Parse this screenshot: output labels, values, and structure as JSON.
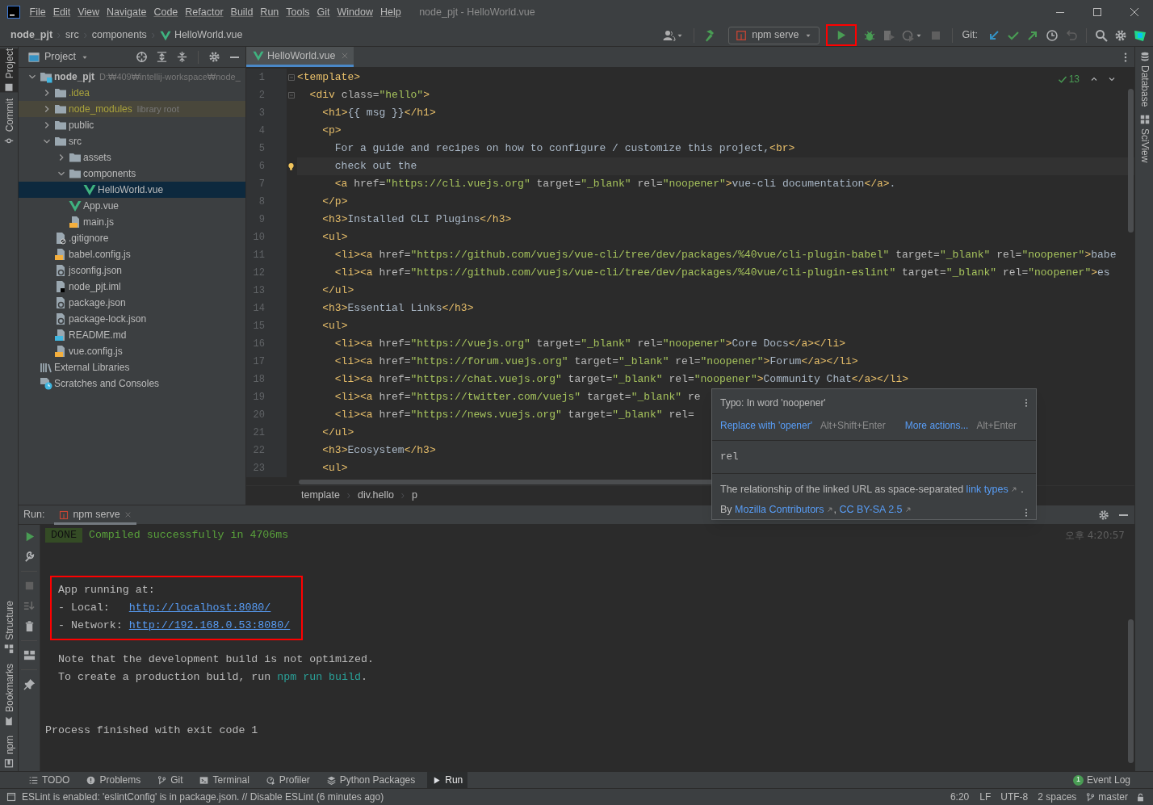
{
  "window": {
    "title": "node_pjt - HelloWorld.vue"
  },
  "menu": [
    "File",
    "Edit",
    "View",
    "Navigate",
    "Code",
    "Refactor",
    "Build",
    "Run",
    "Tools",
    "Git",
    "Window",
    "Help"
  ],
  "breadcrumbs": [
    {
      "label": "node_pjt",
      "kind": "project"
    },
    {
      "label": "src",
      "kind": "folder"
    },
    {
      "label": "components",
      "kind": "folder"
    },
    {
      "label": "HelloWorld.vue",
      "kind": "vue"
    }
  ],
  "toolbar": {
    "run_config": "npm serve",
    "run_highlighted": true,
    "git_label": "Git:"
  },
  "left_strip": {
    "top": [
      {
        "label": "Project",
        "selected": true
      },
      {
        "label": "Commit",
        "selected": false
      }
    ],
    "bottom": [
      {
        "label": "Structure",
        "selected": false
      },
      {
        "label": "Bookmarks",
        "selected": false
      },
      {
        "label": "npm",
        "selected": false
      }
    ]
  },
  "right_strip": [
    {
      "label": "Database",
      "kind": "database"
    },
    {
      "label": "SciView",
      "kind": "sciview"
    }
  ],
  "project_panel": {
    "title": "Project",
    "tree": [
      {
        "name": "node_pjt",
        "kind": "module",
        "hint": "D:₩409₩intellij-workspace₩node_",
        "expanded": true,
        "selected": false,
        "children": [
          {
            "name": ".idea",
            "kind": "folder",
            "ignored": true,
            "expanded": false,
            "selected": false
          },
          {
            "name": "node_modules",
            "kind": "library_folder",
            "ignored": true,
            "hint": "library root",
            "expanded": false,
            "selected": false
          },
          {
            "name": "public",
            "kind": "folder",
            "expanded": false,
            "selected": false
          },
          {
            "name": "src",
            "kind": "folder",
            "expanded": true,
            "selected": false,
            "children": [
              {
                "name": "assets",
                "kind": "folder",
                "expanded": false,
                "selected": false
              },
              {
                "name": "components",
                "kind": "folder",
                "expanded": true,
                "selected": false,
                "children": [
                  {
                    "name": "HelloWorld.vue",
                    "kind": "vue",
                    "selected": true
                  }
                ]
              },
              {
                "name": "App.vue",
                "kind": "vue",
                "selected": false
              },
              {
                "name": "main.js",
                "kind": "js",
                "selected": false
              }
            ]
          },
          {
            "name": ".gitignore",
            "kind": "gitignore",
            "selected": false
          },
          {
            "name": "babel.config.js",
            "kind": "js",
            "selected": false
          },
          {
            "name": "jsconfig.json",
            "kind": "json",
            "selected": false
          },
          {
            "name": "node_pjt.iml",
            "kind": "iml",
            "selected": false
          },
          {
            "name": "package.json",
            "kind": "json",
            "selected": false
          },
          {
            "name": "package-lock.json",
            "kind": "json",
            "selected": false
          },
          {
            "name": "README.md",
            "kind": "md",
            "selected": false
          },
          {
            "name": "vue.config.js",
            "kind": "js",
            "selected": false
          }
        ]
      },
      {
        "name": "External Libraries",
        "kind": "libraries",
        "selected": false
      },
      {
        "name": "Scratches and Consoles",
        "kind": "scratches",
        "selected": false
      }
    ]
  },
  "editor": {
    "tabs": [
      {
        "label": "HelloWorld.vue",
        "selected": true
      }
    ],
    "inspection_count": "13",
    "lines": [
      {
        "number": "1",
        "text": "<template>",
        "fold": true,
        "current": false
      },
      {
        "number": "2",
        "text": "  <div class=\"hello\">",
        "fold": true,
        "current": false
      },
      {
        "number": "3",
        "text": "    <h1>{{ msg }}</h1>",
        "fold": false,
        "current": false
      },
      {
        "number": "4",
        "text": "    <p>",
        "fold": false,
        "current": false
      },
      {
        "number": "5",
        "text": "      For a guide and recipes on how to configure / customize this project,<br>",
        "fold": false,
        "current": false
      },
      {
        "number": "6",
        "text": "      check out the",
        "fold": false,
        "current": true
      },
      {
        "number": "7",
        "text": "      <a href=\"https://cli.vuejs.org\" target=\"_blank\" rel=\"noopener\">vue-cli documentation</a>.",
        "fold": false,
        "current": false
      },
      {
        "number": "8",
        "text": "    </p>",
        "fold": false,
        "current": false
      },
      {
        "number": "9",
        "text": "    <h3>Installed CLI Plugins</h3>",
        "fold": false,
        "current": false
      },
      {
        "number": "10",
        "text": "    <ul>",
        "fold": false,
        "current": false
      },
      {
        "number": "11",
        "text": "      <li><a href=\"https://github.com/vuejs/vue-cli/tree/dev/packages/%40vue/cli-plugin-babel\" target=\"_blank\" rel=\"noopener\">babe",
        "fold": false,
        "current": false
      },
      {
        "number": "12",
        "text": "      <li><a href=\"https://github.com/vuejs/vue-cli/tree/dev/packages/%40vue/cli-plugin-eslint\" target=\"_blank\" rel=\"noopener\">es",
        "fold": false,
        "current": false
      },
      {
        "number": "13",
        "text": "    </ul>",
        "fold": false,
        "current": false
      },
      {
        "number": "14",
        "text": "    <h3>Essential Links</h3>",
        "fold": false,
        "current": false
      },
      {
        "number": "15",
        "text": "    <ul>",
        "fold": false,
        "current": false
      },
      {
        "number": "16",
        "text": "      <li><a href=\"https://vuejs.org\" target=\"_blank\" rel=\"noopener\">Core Docs</a></li>",
        "fold": false,
        "current": false
      },
      {
        "number": "17",
        "text": "      <li><a href=\"https://forum.vuejs.org\" target=\"_blank\" rel=\"noopener\">Forum</a></li>",
        "fold": false,
        "current": false
      },
      {
        "number": "18",
        "text": "      <li><a href=\"https://chat.vuejs.org\" target=\"_blank\" rel=\"noopener\">Community Chat</a></li>",
        "fold": false,
        "current": false
      },
      {
        "number": "19",
        "text": "      <li><a href=\"https://twitter.com/vuejs\" target=\"_blank\" re",
        "fold": false,
        "current": false
      },
      {
        "number": "20",
        "text": "      <li><a href=\"https://news.vuejs.org\" target=\"_blank\" rel=",
        "fold": false,
        "current": false
      },
      {
        "number": "21",
        "text": "    </ul>",
        "fold": false,
        "current": false
      },
      {
        "number": "22",
        "text": "    <h3>Ecosystem</h3>",
        "fold": false,
        "current": false
      },
      {
        "number": "23",
        "text": "    <ul>",
        "fold": false,
        "current": false
      }
    ],
    "breadcrumbs": [
      "template",
      "div.hello",
      "p"
    ]
  },
  "popup": {
    "title": "Typo: In word 'noopener'",
    "actions": [
      {
        "label": "Replace with 'opener'",
        "shortcut": "Alt+Shift+Enter"
      },
      {
        "label": "More actions...",
        "shortcut": "Alt+Enter"
      }
    ],
    "element": "rel",
    "description": [
      {
        "text": "The relationship of the linked URL as space-separated ",
        "kind": "plain"
      },
      {
        "text": "link types",
        "kind": "link"
      },
      {
        "text": " .",
        "kind": "plain"
      }
    ],
    "attribution": [
      {
        "text": "By ",
        "kind": "plain"
      },
      {
        "text": "Mozilla Contributors",
        "kind": "link"
      },
      {
        "text": ", ",
        "kind": "plain"
      },
      {
        "text": "CC BY-SA 2.5",
        "kind": "link"
      }
    ]
  },
  "run_panel": {
    "label": "Run:",
    "tabs": [
      {
        "label": "npm serve",
        "selected": true
      }
    ],
    "timestamp": "오후 4:20:57",
    "console": [
      {
        "kind": "done",
        "badge": "DONE",
        "text": "Compiled successfully in 4706ms"
      },
      {
        "kind": "box",
        "highlighted": true,
        "lines": [
          [
            {
              "text": "App running at:",
              "kind": "plain"
            }
          ],
          [
            {
              "text": "- Local:   ",
              "kind": "plain"
            },
            {
              "text": "http://localhost:8080/",
              "kind": "link"
            }
          ],
          [
            {
              "text": "- Network: ",
              "kind": "plain"
            },
            {
              "text": "http://192.168.0.53:8080/",
              "kind": "link"
            }
          ]
        ]
      },
      {
        "kind": "text",
        "segments": [
          {
            "text": "  Note that the development build is not optimized.",
            "kind": "plain"
          }
        ]
      },
      {
        "kind": "text",
        "segments": [
          {
            "text": "  To create a production build, run ",
            "kind": "plain"
          },
          {
            "text": "npm run build",
            "kind": "command"
          },
          {
            "text": ".",
            "kind": "plain"
          }
        ]
      },
      {
        "kind": "blank"
      },
      {
        "kind": "blank"
      },
      {
        "kind": "text",
        "segments": [
          {
            "text": "Process finished with exit code 1",
            "kind": "plain"
          }
        ]
      }
    ]
  },
  "tool_tabs": [
    {
      "label": "TODO",
      "kind": "todo",
      "selected": false
    },
    {
      "label": "Problems",
      "kind": "problems",
      "selected": false
    },
    {
      "label": "Git",
      "kind": "git",
      "selected": false
    },
    {
      "label": "Terminal",
      "kind": "terminal",
      "selected": false
    },
    {
      "label": "Profiler",
      "kind": "profiler",
      "selected": false
    },
    {
      "label": "Python Packages",
      "kind": "packages",
      "selected": false
    },
    {
      "label": "Run",
      "kind": "run",
      "selected": true
    }
  ],
  "event_log": {
    "label": "Event Log",
    "count": "1"
  },
  "status_bar": {
    "message": "ESLint is enabled: 'eslintConfig' is in package.json. // Disable ESLint (6 minutes ago)",
    "position": "6:20",
    "line_separator": "LF",
    "encoding": "UTF-8",
    "indent": "2 spaces",
    "branch": "master"
  }
}
